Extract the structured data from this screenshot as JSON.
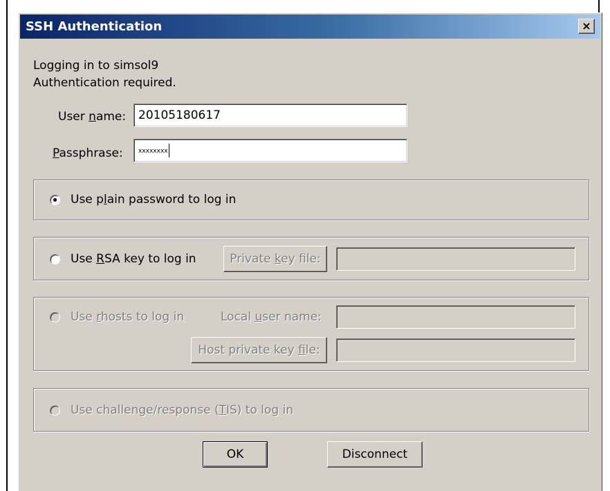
{
  "dialog": {
    "title": "SSH Authentication",
    "close_glyph": "×"
  },
  "status": {
    "line1": "Logging in to simsol9",
    "line2": "Authentication required."
  },
  "username": {
    "label_pre": "User ",
    "label_mnemonic": "n",
    "label_post": "ame:",
    "value": "20105180617"
  },
  "passphrase": {
    "label_mnemonic": "P",
    "label_post": "assphrase:",
    "masked_value": "xxxxxxxx"
  },
  "methods": {
    "plain": {
      "label_pre": "Use p",
      "label_mnemonic": "l",
      "label_post": "ain password to log in",
      "selected": true
    },
    "rsa": {
      "label_pre": "Use ",
      "label_mnemonic": "R",
      "label_post": "SA key to log in",
      "selected": false,
      "key_button": {
        "pre": "Private ",
        "mnemonic": "k",
        "post": "ey file:"
      },
      "key_value": ""
    },
    "rhosts": {
      "label_pre": "Use ",
      "label_mnemonic": "r",
      "label_post": "hosts to log in",
      "enabled": false,
      "local_user_label": {
        "pre": "Local ",
        "mnemonic": "u",
        "post": "ser name:"
      },
      "local_user_value": "",
      "host_key_button": {
        "pre": "Host private key ",
        "mnemonic": "f",
        "post": "ile:"
      },
      "host_key_value": ""
    },
    "tis": {
      "label_pre": "Use challenge/response (",
      "label_mnemonic": "T",
      "label_post": "IS) to log in",
      "enabled": false
    }
  },
  "buttons": {
    "ok": "OK",
    "disconnect": "Disconnect"
  }
}
